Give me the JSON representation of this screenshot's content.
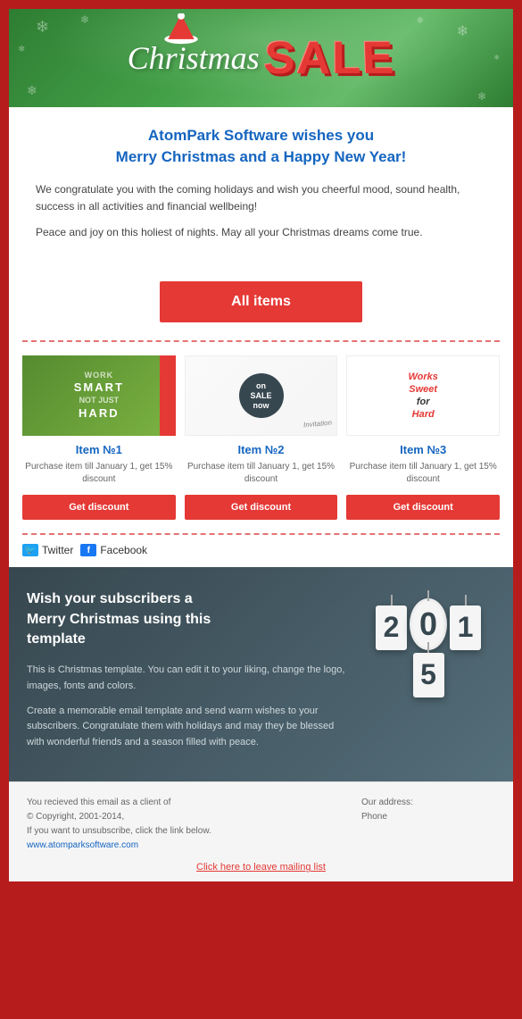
{
  "header": {
    "christmas_text": "Christmas",
    "sale_text": "SALE"
  },
  "greeting": {
    "title": "AtomPark Software wishes you\nMerry Christmas and a Happy New Year!",
    "paragraph1": "We congratulate you with the coming holidays and wish you cheerful mood, sound health, success in all activities and financial wellbeing!",
    "paragraph2": "Peace and joy on this holiest of nights. May all your Christmas dreams come true."
  },
  "cta": {
    "button_label": "All items"
  },
  "products": [
    {
      "name": "Item №1",
      "desc": "Purchase item till January 1, get 15% discount",
      "button_label": "Get discount",
      "image_text": "SMART\nHARD"
    },
    {
      "name": "Item №2",
      "desc": "Purchase item till January 1, get 15% discount",
      "button_label": "Get discount",
      "image_text": "on\nSALE\nnow"
    },
    {
      "name": "Item №3",
      "desc": "Purchase item till January 1, get 15% discount",
      "button_label": "Get discount",
      "image_text": "Works\nSweet\nfor\nHard"
    }
  ],
  "social": {
    "twitter_label": "Twitter",
    "facebook_label": "Facebook"
  },
  "promo": {
    "title": "Wish your subscribers a\nMerry Christmas using this\ntemplate",
    "paragraph1": "This is Christmas template. You can edit it to your liking, change the logo, images, fonts and colors.",
    "paragraph2": "Create a memorable email template and send warm wishes to your subscribers. Congratulate them with holidays and may they be blessed with wonderful friends and a season filled with peace.",
    "year": "2015"
  },
  "footer": {
    "left_text1": "You recieved this email as a client of",
    "left_text2": "© Copyright, 2001-2014,",
    "left_text3": "If you want to unsubscribe, click the link below.",
    "left_text4": "www.atomparksoftware.com",
    "right_text1": "Our address:",
    "right_text2": "",
    "right_text3": "Phone",
    "unsubscribe_label": "Click here to leave mailing list"
  }
}
